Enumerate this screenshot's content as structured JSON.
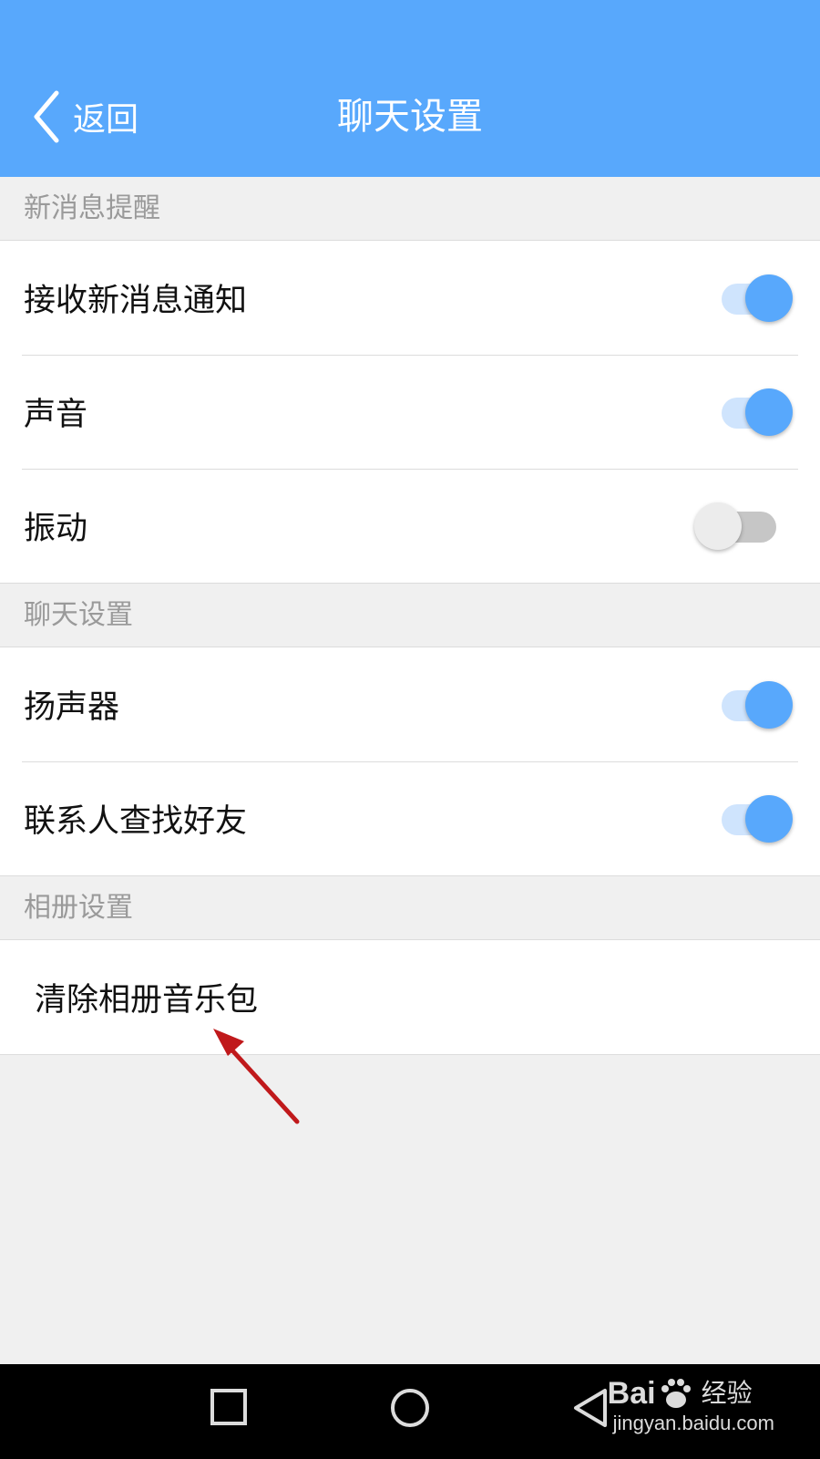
{
  "header": {
    "back_label": "返回",
    "title": "聊天设置",
    "bg_color": "#58a8fc"
  },
  "sections": [
    {
      "title": "新消息提醒",
      "rows": [
        {
          "label": "接收新消息通知",
          "toggle": "on"
        },
        {
          "label": "声音",
          "toggle": "on"
        },
        {
          "label": "振动",
          "toggle": "off"
        }
      ]
    },
    {
      "title": "聊天设置",
      "rows": [
        {
          "label": "扬声器",
          "toggle": "on"
        },
        {
          "label": "联系人查找好友",
          "toggle": "on"
        }
      ]
    },
    {
      "title": "相册设置",
      "rows": [
        {
          "label": "清除相册音乐包"
        }
      ]
    }
  ],
  "annotation": {
    "icon": "red-arrow-icon",
    "color": "#c0191b"
  },
  "navbar": {
    "buttons": [
      "recent-apps-icon",
      "home-icon",
      "back-triangle-icon"
    ]
  },
  "watermark": {
    "brand": "Bai",
    "brand_suffix": "经验",
    "url": "jingyan.baidu.com"
  }
}
